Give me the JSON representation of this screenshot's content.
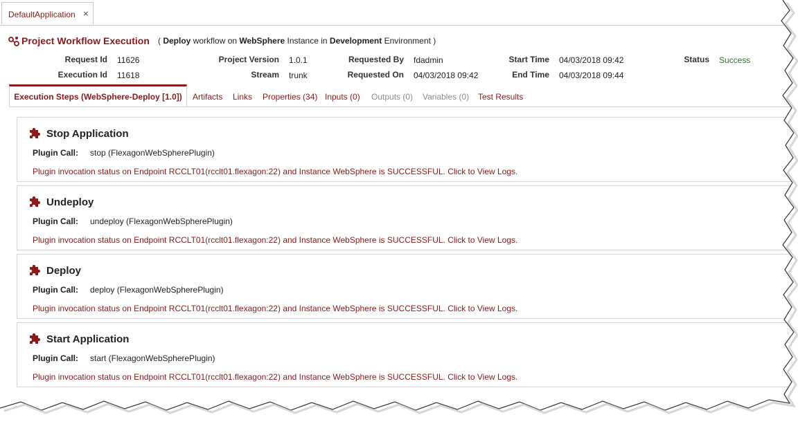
{
  "app_tab": {
    "label": "DefaultApplication",
    "close": "×"
  },
  "header": {
    "title": "Project Workflow Execution",
    "subtitle_open": "( ",
    "subtitle_deploy": "Deploy",
    "subtitle_workflow_on": " workflow on ",
    "subtitle_instance_name": "WebSphere",
    "subtitle_instance_in": " Instance in ",
    "subtitle_env_name": "Development",
    "subtitle_env": " Environment )"
  },
  "info": {
    "request_id_label": "Request Id",
    "request_id": "11626",
    "execution_id_label": "Execution Id",
    "execution_id": "11618",
    "project_version_label": "Project Version",
    "project_version": "1.0.1",
    "stream_label": "Stream",
    "stream": "trunk",
    "requested_by_label": "Requested By",
    "requested_by": "fdadmin",
    "requested_on_label": "Requested On",
    "requested_on": "04/03/2018 09:42",
    "start_time_label": "Start Time",
    "start_time": "04/03/2018 09:42",
    "end_time_label": "End Time",
    "end_time": "04/03/2018 09:44",
    "status_label": "Status",
    "status": "Success"
  },
  "tabs": [
    {
      "label": "Execution Steps (WebSphere-Deploy [1.0])",
      "state": "active"
    },
    {
      "label": "Artifacts",
      "state": "enabled"
    },
    {
      "label": "Links",
      "state": "enabled"
    },
    {
      "label": "Properties (34)",
      "state": "enabled"
    },
    {
      "label": "Inputs (0)",
      "state": "enabled"
    },
    {
      "label": "Outputs (0)",
      "state": "disabled"
    },
    {
      "label": "Variables (0)",
      "state": "disabled"
    },
    {
      "label": "Test Results",
      "state": "enabled"
    }
  ],
  "plugin_call_label": "Plugin Call:",
  "steps": [
    {
      "title": "Stop Application",
      "call": "stop (FlexagonWebSpherePlugin)",
      "status": "Plugin invocation status on Endpoint RCCLT01(rcclt01.flexagon:22) and Instance WebSphere is SUCCESSFUL. Click to View Logs."
    },
    {
      "title": "Undeploy",
      "call": "undeploy (FlexagonWebSpherePlugin)",
      "status": "Plugin invocation status on Endpoint RCCLT01(rcclt01.flexagon:22) and Instance WebSphere is SUCCESSFUL. Click to View Logs."
    },
    {
      "title": "Deploy",
      "call": "deploy (FlexagonWebSpherePlugin)",
      "status": "Plugin invocation status on Endpoint RCCLT01(rcclt01.flexagon:22) and Instance WebSphere is SUCCESSFUL. Click to View Logs."
    },
    {
      "title": "Start Application",
      "call": "start (FlexagonWebSpherePlugin)",
      "status": "Plugin invocation status on Endpoint RCCLT01(rcclt01.flexagon:22) and Instance WebSphere is SUCCESSFUL. Click to View Logs."
    }
  ],
  "colors": {
    "accent": "#8b1a1a",
    "success": "#2a7a2a",
    "disabled": "#8c8c8c"
  },
  "icons": {
    "workflow": "workflow-icon",
    "step": "puzzle-piece-icon"
  }
}
